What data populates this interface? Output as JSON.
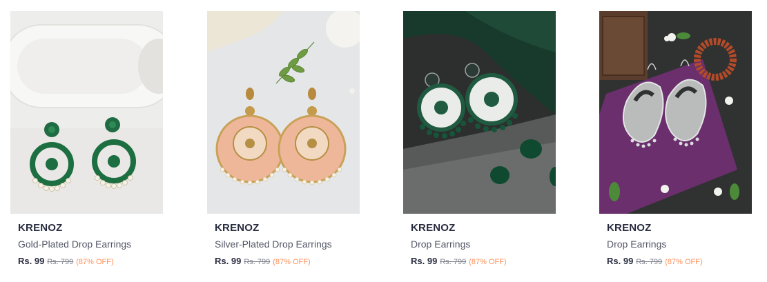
{
  "products": [
    {
      "brand": "KRENOZ",
      "name": "Gold-Plated Drop Earrings",
      "price": "Rs. 99",
      "mrp": "Rs. 799",
      "discount": "(87% OFF)",
      "image_icon": "earrings-image"
    },
    {
      "brand": "KRENOZ",
      "name": "Silver-Plated Drop Earrings",
      "price": "Rs. 99",
      "mrp": "Rs. 799",
      "discount": "(87% OFF)",
      "image_icon": "earrings-image"
    },
    {
      "brand": "KRENOZ",
      "name": "Drop Earrings",
      "price": "Rs. 99",
      "mrp": "Rs. 799",
      "discount": "(87% OFF)",
      "image_icon": "earrings-image"
    },
    {
      "brand": "KRENOZ",
      "name": "Drop Earrings",
      "price": "Rs. 99",
      "mrp": "Rs. 799",
      "discount": "(87% OFF)",
      "image_icon": "earrings-image"
    }
  ],
  "colors": {
    "brand_text": "#282c3f",
    "name_text": "#535766",
    "mrp_text": "#7e818c",
    "discount_text": "#ff905a"
  }
}
